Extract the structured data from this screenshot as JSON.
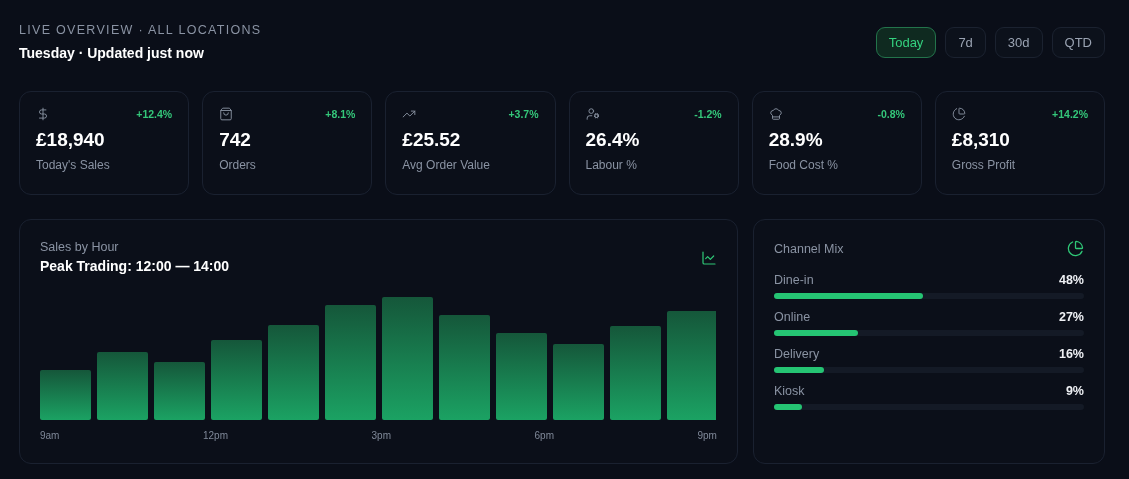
{
  "header": {
    "eyebrow": "LIVE OVERVIEW · ALL LOCATIONS",
    "title": "Tuesday · Updated just now"
  },
  "ranges": [
    {
      "label": "Today",
      "selected": true
    },
    {
      "label": "7d",
      "selected": false
    },
    {
      "label": "30d",
      "selected": false
    },
    {
      "label": "QTD",
      "selected": false
    }
  ],
  "kpis": [
    {
      "value": "£18,940",
      "label": "Today's Sales",
      "delta": "+12.4%"
    },
    {
      "value": "742",
      "label": "Orders",
      "delta": "+8.1%"
    },
    {
      "value": "£25.52",
      "label": "Avg Order Value",
      "delta": "+3.7%"
    },
    {
      "value": "26.4%",
      "label": "Labour %",
      "delta": "-1.2%"
    },
    {
      "value": "28.9%",
      "label": "Food Cost %",
      "delta": "-0.8%"
    },
    {
      "value": "£8,310",
      "label": "Gross Profit",
      "delta": "+14.2%"
    }
  ],
  "sales_by_hour": {
    "title": "Sales by Hour",
    "subtitle": "Peak Trading: 12:00 — 14:00",
    "axis_labels": [
      "9am",
      "12pm",
      "3pm",
      "6pm",
      "9pm"
    ]
  },
  "channel_mix": {
    "title": "Channel Mix",
    "channels": [
      {
        "name": "Dine-in",
        "reading": "48%",
        "level": 0.48
      },
      {
        "name": "Online",
        "reading": "27%",
        "level": 0.27
      },
      {
        "name": "Delivery",
        "reading": "16%",
        "level": 0.16
      },
      {
        "name": "Kiosk",
        "reading": "9%",
        "level": 0.09
      }
    ]
  }
}
